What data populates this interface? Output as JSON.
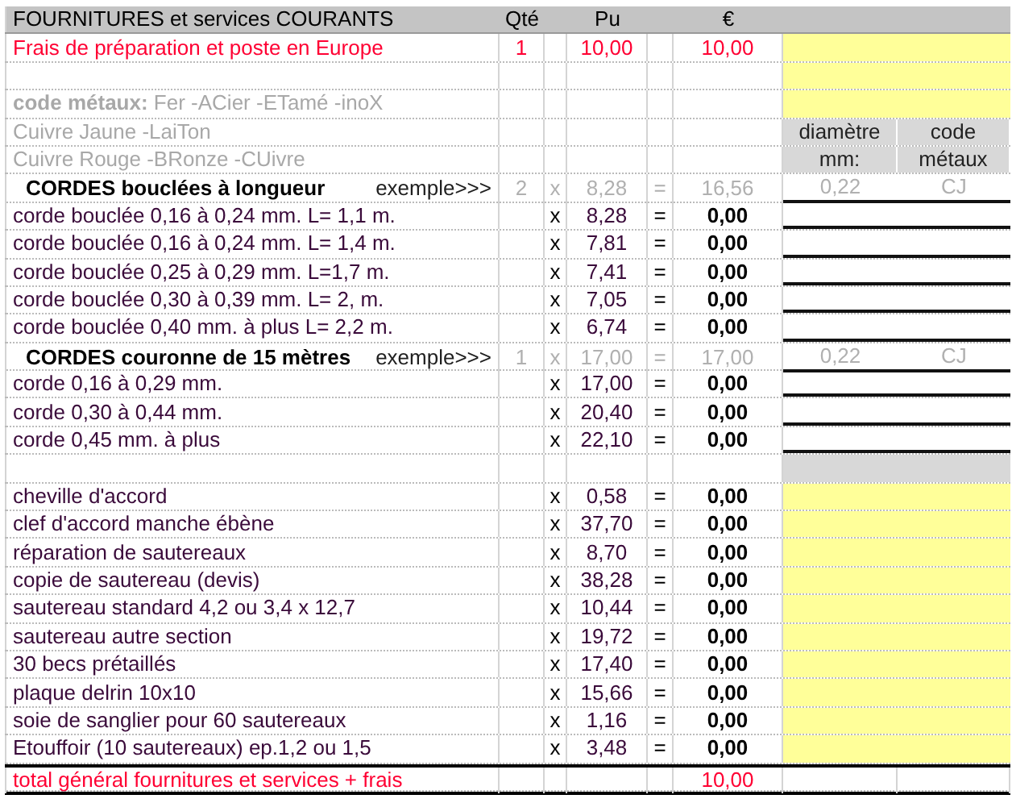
{
  "header": {
    "label": "FOURNITURES et services COURANTS",
    "qty": "Qté",
    "unit_price": "Pu",
    "total": "€"
  },
  "rows": [
    {
      "kind": "fee",
      "label": "Frais de préparation et poste en Europe",
      "qty": "1",
      "unit_price": "10,00",
      "total": "10,00",
      "side": {
        "kind": "yellow"
      }
    },
    {
      "kind": "blank",
      "side": {
        "kind": "yellow"
      }
    },
    {
      "kind": "note",
      "label": "**code métaux:** Fer -ACier -ETamé -inoX",
      "side": {
        "kind": "yellow"
      }
    },
    {
      "kind": "note",
      "label": "Cuivre Jaune -LaiTon",
      "side": {
        "kind": "label",
        "cells": [
          "diamètre",
          "code"
        ]
      }
    },
    {
      "kind": "note",
      "label": "Cuivre Rouge -BRonze -CUivre",
      "side": {
        "kind": "label",
        "cells": [
          "mm:",
          "métaux"
        ]
      }
    },
    {
      "kind": "section",
      "label": "CORDES bouclées à longueur",
      "hint": "exemple>>>",
      "qty": "2",
      "times": "x",
      "unit_price": "8,28",
      "equals": "=",
      "total": "16,56",
      "side": {
        "kind": "example",
        "cells": [
          "0,22",
          "CJ"
        ]
      }
    },
    {
      "kind": "item",
      "label": "corde  bouclée 0,16 à 0,24 mm. L= 1,1 m.",
      "times": "x",
      "unit_price": "8,28",
      "equals": "=",
      "total": "0,00",
      "side": {
        "kind": "input"
      }
    },
    {
      "kind": "item",
      "label": "corde  bouclée 0,16 à 0,24 mm. L= 1,4 m.",
      "times": "x",
      "unit_price": "7,81",
      "equals": "=",
      "total": "0,00",
      "side": {
        "kind": "input"
      }
    },
    {
      "kind": "item",
      "label": "corde bouclée 0,25 à 0,29 mm. L=1,7 m.",
      "times": "x",
      "unit_price": "7,41",
      "equals": "=",
      "total": "0,00",
      "side": {
        "kind": "input"
      }
    },
    {
      "kind": "item",
      "label": "corde bouclée 0,30 à 0,39 mm. L= 2, m.",
      "times": "x",
      "unit_price": "7,05",
      "equals": "=",
      "total": "0,00",
      "side": {
        "kind": "input"
      }
    },
    {
      "kind": "item",
      "label": "corde bouclée 0,40 mm. à plus L= 2,2 m.",
      "times": "x",
      "unit_price": "6,74",
      "equals": "=",
      "total": "0,00",
      "side": {
        "kind": "input"
      }
    },
    {
      "kind": "section",
      "label": "CORDES couronne de 15 mètres",
      "hint": "exemple>>>",
      "qty": "1",
      "times": "x",
      "unit_price": "17,00",
      "equals": "=",
      "total": "17,00",
      "side": {
        "kind": "example",
        "cells": [
          "0,22",
          "CJ"
        ]
      }
    },
    {
      "kind": "item",
      "label": "corde  0,16 à 0,29 mm.",
      "times": "x",
      "unit_price": "17,00",
      "equals": "=",
      "total": "0,00",
      "side": {
        "kind": "input"
      }
    },
    {
      "kind": "item",
      "label": "corde  0,30 à 0,44 mm.",
      "times": "x",
      "unit_price": "20,40",
      "equals": "=",
      "total": "0,00",
      "side": {
        "kind": "input"
      }
    },
    {
      "kind": "item",
      "label": "corde  0,45 mm. à plus",
      "times": "x",
      "unit_price": "22,10",
      "equals": "=",
      "total": "0,00",
      "side": {
        "kind": "input"
      }
    },
    {
      "kind": "blank",
      "side": {
        "kind": "grey"
      }
    },
    {
      "kind": "item",
      "label": "cheville d'accord",
      "times": "x",
      "unit_price": "0,58",
      "equals": "=",
      "total": "0,00",
      "side": {
        "kind": "yellow"
      }
    },
    {
      "kind": "item",
      "label": "clef d'accord manche ébène",
      "times": "x",
      "unit_price": "37,70",
      "equals": "=",
      "total": "0,00",
      "side": {
        "kind": "yellow"
      }
    },
    {
      "kind": "item",
      "label": "réparation de sautereaux",
      "times": "x",
      "unit_price": "8,70",
      "equals": "=",
      "total": "0,00",
      "side": {
        "kind": "yellow"
      }
    },
    {
      "kind": "item",
      "label": "copie de sautereau (devis)",
      "times": "x",
      "unit_price": "38,28",
      "equals": "=",
      "total": "0,00",
      "side": {
        "kind": "yellow"
      }
    },
    {
      "kind": "item",
      "label": "sautereau standard 4,2 ou 3,4 x 12,7",
      "times": "x",
      "unit_price": "10,44",
      "equals": "=",
      "total": "0,00",
      "side": {
        "kind": "yellow"
      }
    },
    {
      "kind": "item",
      "label": "sautereau autre section",
      "times": "x",
      "unit_price": "19,72",
      "equals": "=",
      "total": "0,00",
      "side": {
        "kind": "yellow"
      }
    },
    {
      "kind": "item",
      "label": "30 becs prétaillés",
      "times": "x",
      "unit_price": "17,40",
      "equals": "=",
      "total": "0,00",
      "side": {
        "kind": "yellow"
      }
    },
    {
      "kind": "item",
      "label": "plaque delrin 10x10",
      "times": "x",
      "unit_price": "15,66",
      "equals": "=",
      "total": "0,00",
      "side": {
        "kind": "yellow"
      }
    },
    {
      "kind": "item",
      "label": "soie de sanglier pour 60 sautereaux",
      "times": "x",
      "unit_price": "1,16",
      "equals": "=",
      "total": "0,00",
      "side": {
        "kind": "yellow"
      }
    },
    {
      "kind": "item",
      "label": "Etouffoir (10 sautereaux)  ep.1,2 ou 1,5",
      "times": "x",
      "unit_price": "3,48",
      "equals": "=",
      "total": "0,00",
      "side": {
        "kind": "yellow"
      }
    },
    {
      "kind": "total",
      "label": "total général fournitures et services + frais",
      "total": "10,00",
      "side": {
        "kind": "blank"
      }
    }
  ]
}
